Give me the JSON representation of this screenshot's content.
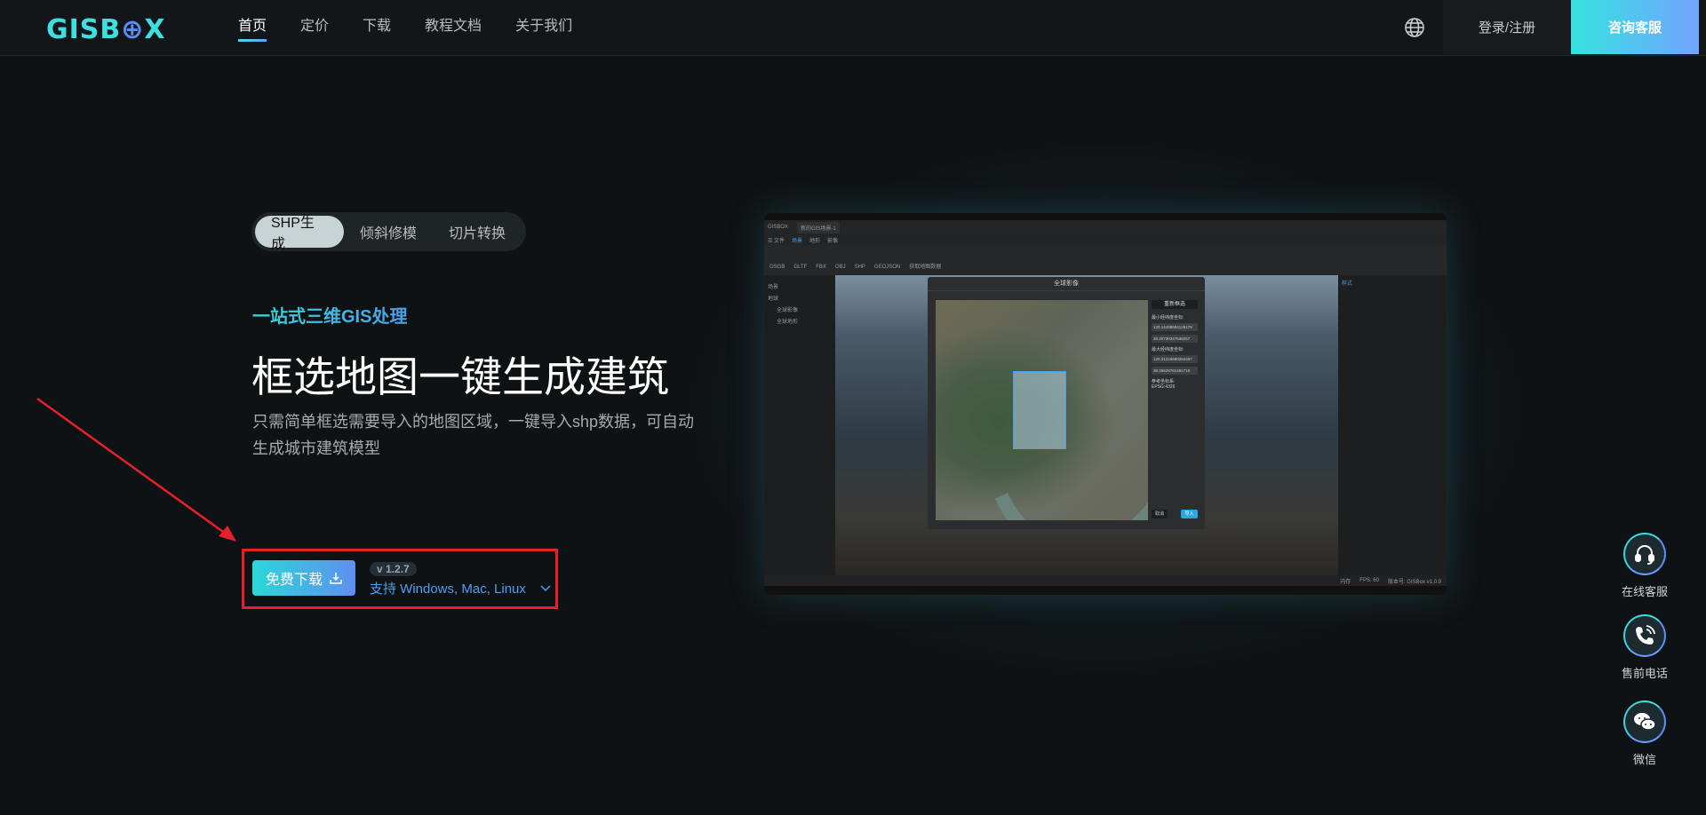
{
  "header": {
    "logo": "GISBOX",
    "nav": [
      "首页",
      "定价",
      "下载",
      "教程文档",
      "关于我们"
    ],
    "login": "登录/注册",
    "consult": "咨询客服"
  },
  "hero": {
    "tabs": [
      "SHP生成",
      "倾斜修模",
      "切片转换"
    ],
    "kicker": "一站式三维GIS处理",
    "title": "框选地图一键生成建筑",
    "description": "只需简单框选需要导入的地图区域，一键导入shp数据，可自动生成城市建筑模型",
    "download_label": "免费下载",
    "version": "v 1.2.7",
    "support": "支持 Windows, Mac, Linux"
  },
  "app_preview": {
    "app_name": "GISBOX",
    "doc_tab": "新的GIS场景-1",
    "menu": [
      "☰ 文件",
      "场景",
      "地形",
      "影像"
    ],
    "toolbar": [
      "OSGB",
      "GLTF",
      "FBX",
      "OBJ",
      "SHP",
      "GEOJSON",
      "获取地图数据"
    ],
    "sidebar": [
      "场景",
      "地球",
      "全球影像",
      "全球地形"
    ],
    "right_panel": "样式",
    "dialog": {
      "title": "全球影像",
      "reselect": "重新框选",
      "min_label": "最小经纬度坐标:",
      "min_lon": "120.14488684125179",
      "min_lat": "30.20730347646257",
      "max_label": "最大经纬度坐标:",
      "max_lon": "120.21315880284487",
      "max_lat": "30.26628761491719",
      "crs": "参考坐标系: EPSG:4326",
      "cancel": "取消",
      "import": "导入"
    },
    "status": [
      "内存",
      "FPS: 60",
      "版本号: GISBox v1.0.9"
    ]
  },
  "float_bar": [
    "在线客服",
    "售前电话",
    "微信"
  ],
  "colors": {
    "accent": "#3de0e0",
    "accent2": "#6aa0ff",
    "annotation": "#e8202a"
  }
}
